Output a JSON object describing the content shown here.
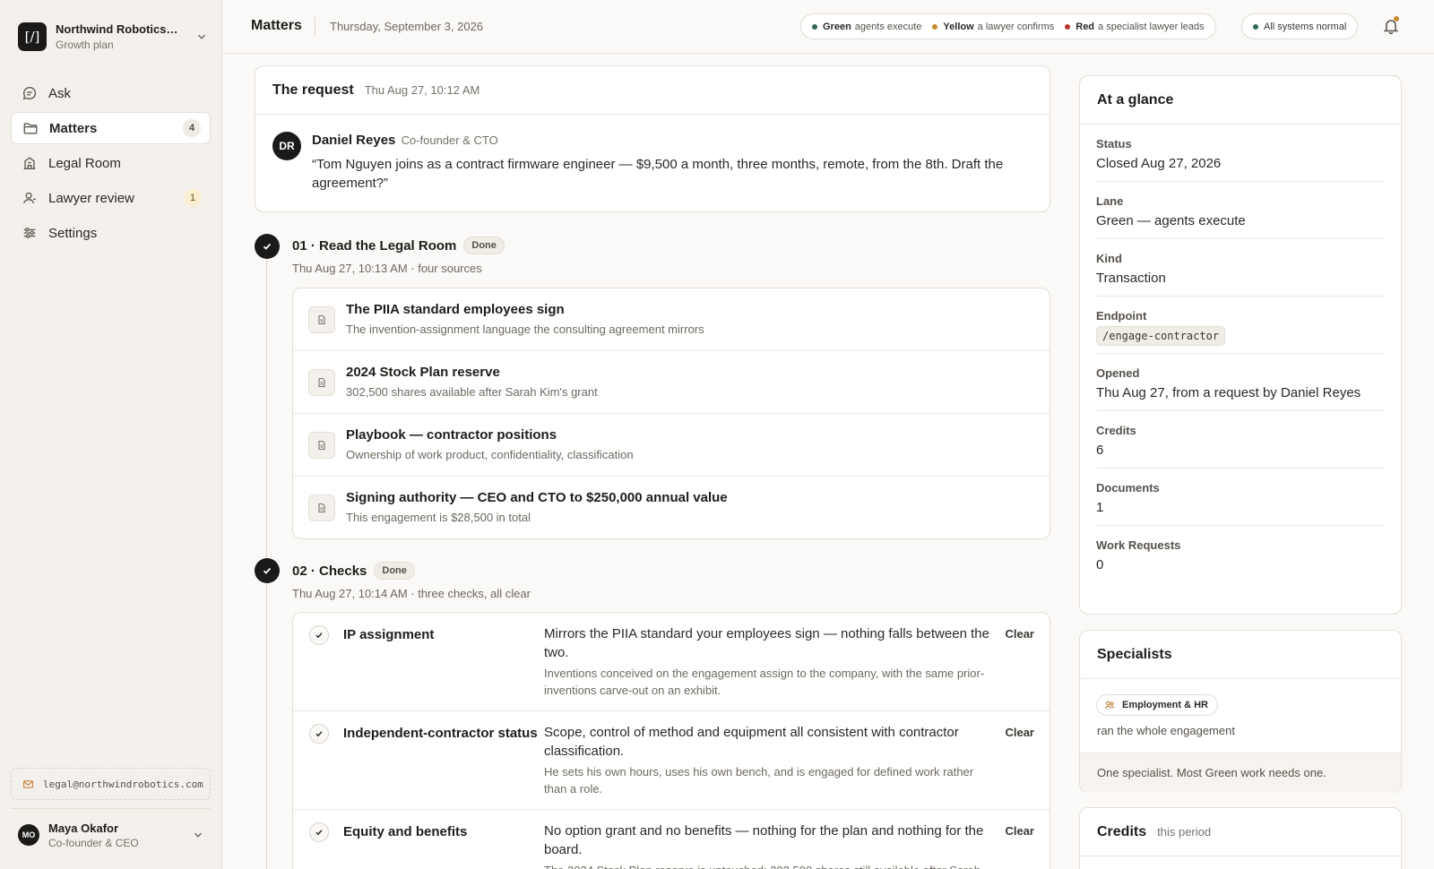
{
  "org": {
    "logo": "[/]",
    "name": "Northwind Robotics, ...",
    "plan": "Growth plan"
  },
  "nav": [
    {
      "label": "Ask",
      "icon": "chat-icon"
    },
    {
      "label": "Matters",
      "icon": "folder-icon",
      "badge": "4",
      "active": true
    },
    {
      "label": "Legal Room",
      "icon": "building-icon"
    },
    {
      "label": "Lawyer review",
      "icon": "person-icon",
      "badge": "1"
    },
    {
      "label": "Settings",
      "icon": "sliders-icon"
    }
  ],
  "email": "legal@northwindrobotics.com",
  "user": {
    "initials": "MO",
    "name": "Maya Okafor",
    "role": "Co-founder & CEO"
  },
  "header": {
    "title": "Matters",
    "date": "Thursday, September 3, 2026",
    "lanes": [
      {
        "name": "Green",
        "desc": "agents execute",
        "color": "#2f6b4f"
      },
      {
        "name": "Yellow",
        "desc": "a lawyer confirms",
        "color": "#c98a2c"
      },
      {
        "name": "Red",
        "desc": "a specialist lawyer leads",
        "color": "#b8372e"
      }
    ],
    "systems": "All systems normal",
    "systems_color": "#2f6b4f"
  },
  "request": {
    "title": "The request",
    "time": "Thu Aug 27, 10:12 AM",
    "initials": "DR",
    "name": "Daniel Reyes",
    "role": "Co-founder & CTO",
    "quote": "“Tom Nguyen joins as a contract firmware engineer — $9,500 a month, three months, remote, from the 8th. Draft the agreement?”"
  },
  "step1": {
    "title": "01 · Read the Legal Room",
    "status": "Done",
    "sub": "Thu Aug 27, 10:13 AM · four sources",
    "sources": [
      {
        "title": "The PIIA standard employees sign",
        "desc": "The invention-assignment language the consulting agreement mirrors"
      },
      {
        "title": "2024 Stock Plan reserve",
        "desc": "302,500 shares available after Sarah Kim's grant"
      },
      {
        "title": "Playbook — contractor positions",
        "desc": "Ownership of work product, confidentiality, classification"
      },
      {
        "title": "Signing authority — CEO and CTO to $250,000 annual value",
        "desc": "This engagement is $28,500 in total"
      }
    ]
  },
  "step2": {
    "title": "02 · Checks",
    "status": "Done",
    "sub": "Thu Aug 27, 10:14 AM · three checks, all clear",
    "checks": [
      {
        "name": "IP assignment",
        "main": "Mirrors the PIIA standard your employees sign — nothing falls between the two.",
        "detail": "Inventions conceived on the engagement assign to the company, with the same prior-inventions carve-out on an exhibit.",
        "result": "Clear"
      },
      {
        "name": "Independent-contractor status",
        "main": "Scope, control of method and equipment all consistent with contractor classification.",
        "detail": "He sets his own hours, uses his own bench, and is engaged for defined work rather than a role.",
        "result": "Clear"
      },
      {
        "name": "Equity and benefits",
        "main": "No option grant and no benefits — nothing for the plan and nothing for the board.",
        "detail": "The 2024 Stock Plan reserve is untouched: 302,500 shares still available after Sarah",
        "result": "Clear"
      }
    ]
  },
  "glance": {
    "title": "At a glance",
    "items": [
      {
        "k": "Status",
        "v": "Closed Aug 27, 2026"
      },
      {
        "k": "Lane",
        "v": "Green — agents execute"
      },
      {
        "k": "Kind",
        "v": "Transaction"
      },
      {
        "k": "Endpoint",
        "v": "/engage-contractor"
      },
      {
        "k": "Opened",
        "v": "Thu Aug 27, from a request by Daniel Reyes"
      },
      {
        "k": "Credits",
        "v": "6"
      },
      {
        "k": "Documents",
        "v": "1"
      },
      {
        "k": "Work Requests",
        "v": "0"
      }
    ]
  },
  "specialists": {
    "title": "Specialists",
    "pill": "Employment & HR",
    "desc": "ran the whole engagement",
    "footer": "One specialist. Most Green work needs one."
  },
  "credits": {
    "title": "Credits",
    "sub": "this period"
  }
}
